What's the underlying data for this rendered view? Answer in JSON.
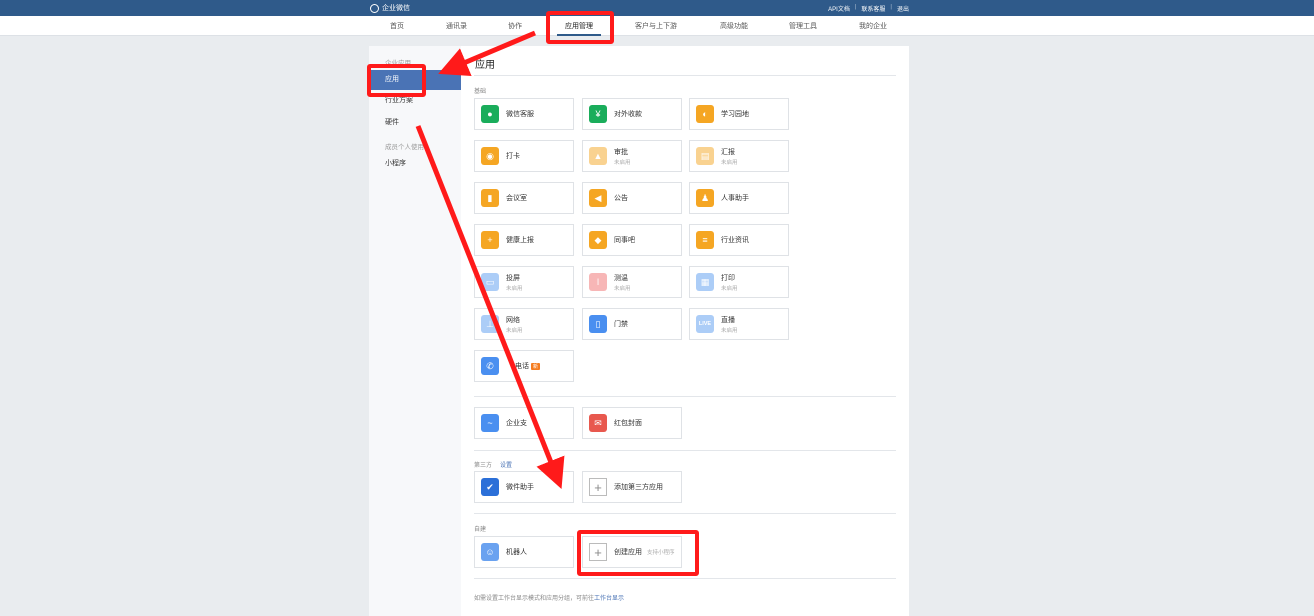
{
  "header": {
    "brand": "企业微信",
    "links": [
      "API文档",
      "联系客服",
      "退出"
    ]
  },
  "nav": {
    "tabs": [
      "首页",
      "通讯录",
      "协作",
      "应用管理",
      "客户与上下游",
      "高级功能",
      "管理工具",
      "我的企业"
    ]
  },
  "sidebar": {
    "group1": "企业应用",
    "items1": [
      "应用",
      "行业方案",
      "硬件"
    ],
    "group2": "成员个人使用",
    "items2": [
      "小程序"
    ]
  },
  "main": {
    "title": "应用",
    "basic_label": "基础",
    "basic_apps": [
      {
        "name": "微信客服",
        "status": "",
        "icon": "chat-bubble-icon",
        "color": "#1aad5b"
      },
      {
        "name": "对外收款",
        "status": "",
        "icon": "yen-icon",
        "color": "#1aad5b"
      },
      {
        "name": "学习园地",
        "status": "",
        "icon": "planet-icon",
        "color": "#f5a623"
      },
      {
        "name": "打卡",
        "status": "",
        "icon": "location-pin-icon",
        "color": "#f5a623"
      },
      {
        "name": "审批",
        "status": "未启用",
        "icon": "stamp-icon",
        "color": "#f5a623"
      },
      {
        "name": "汇报",
        "status": "未启用",
        "icon": "report-icon",
        "color": "#f5a623"
      },
      {
        "name": "会议室",
        "status": "",
        "icon": "door-icon",
        "color": "#f5a623"
      },
      {
        "name": "公告",
        "status": "",
        "icon": "megaphone-icon",
        "color": "#f5a623"
      },
      {
        "name": "人事助手",
        "status": "",
        "icon": "person-icon",
        "color": "#f5a623"
      },
      {
        "name": "健康上报",
        "status": "",
        "icon": "health-clipboard-icon",
        "color": "#f5a623"
      },
      {
        "name": "同事吧",
        "status": "",
        "icon": "diamond-dots-icon",
        "color": "#f5a623"
      },
      {
        "name": "行业资讯",
        "status": "",
        "icon": "news-icon",
        "color": "#f5a623"
      },
      {
        "name": "投屏",
        "status": "未启用",
        "icon": "screen-cast-icon",
        "color": "#5b9cf0"
      },
      {
        "name": "测温",
        "status": "未启用",
        "icon": "thermometer-icon",
        "color": "#f07070"
      },
      {
        "name": "打印",
        "status": "未启用",
        "icon": "printer-icon",
        "color": "#5b9cf0"
      },
      {
        "name": "网络",
        "status": "未启用",
        "icon": "network-icon",
        "color": "#5b9cf0"
      },
      {
        "name": "门禁",
        "status": "",
        "icon": "door-access-icon",
        "color": "#4a8ff0"
      },
      {
        "name": "直播",
        "status": "未启用",
        "icon": "live-icon",
        "color": "#5b9cf0"
      },
      {
        "name": "电话",
        "status": "",
        "icon": "phone-icon",
        "color": "#4a8ff0",
        "badge": "新"
      }
    ],
    "live_text": "LIVE",
    "extra_apps": [
      {
        "name": "企业支",
        "icon": "wave-icon",
        "color": "#4a8ff0"
      },
      {
        "name": "红包封面",
        "icon": "red-packet-icon",
        "color": "#e8584e"
      }
    ],
    "third_label": "第三方",
    "third_link": "设置",
    "third_apps": [
      {
        "name": "微件助手",
        "icon": "check-doc-icon",
        "color": "#2b6fd8"
      },
      {
        "name": "添加第三方应用",
        "icon": "plus-icon"
      }
    ],
    "custom_label": "自建",
    "custom_apps": [
      {
        "name": "机器人",
        "icon": "robot-icon",
        "color": "#6aa2f0"
      },
      {
        "name": "创建应用",
        "hint": "支持小程序",
        "icon": "plus-icon"
      }
    ],
    "footnote": "如需设置工作台显示模式和应用分组，可前往",
    "footnote_link": "工作台显示"
  },
  "colors": {
    "topbar": "#2f5a8a",
    "accent": "#4a73b5",
    "annotation": "#ff1a1a"
  }
}
